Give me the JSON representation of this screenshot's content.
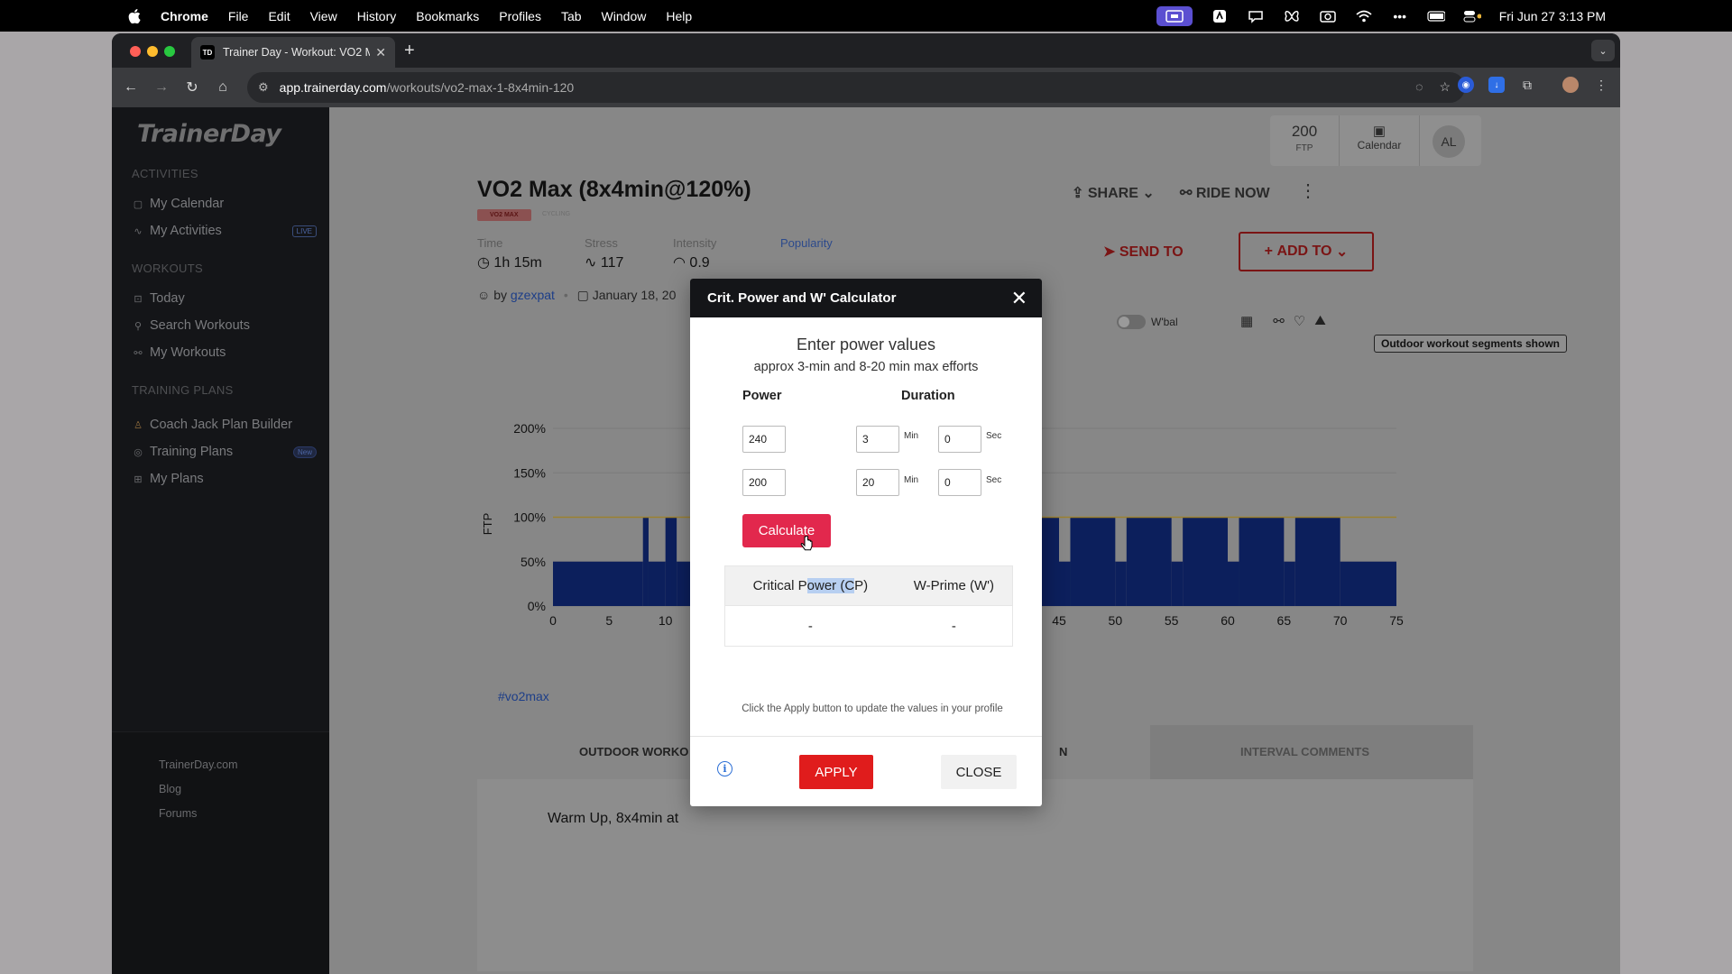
{
  "menubar": {
    "app_name": "Chrome",
    "items": [
      "File",
      "Edit",
      "View",
      "History",
      "Bookmarks",
      "Profiles",
      "Tab",
      "Window",
      "Help"
    ],
    "datetime": "Fri Jun 27  3:13 PM"
  },
  "browser": {
    "tab_title": "Trainer Day - Workout: VO2 M",
    "favicon_text": "TD",
    "url_host": "app.trainerday.com",
    "url_path": "/workouts/vo2-max-1-8x4min-120"
  },
  "sidebar": {
    "logo": "TrainerDay",
    "sections": {
      "activities": "ACTIVITIES",
      "workouts": "WORKOUTS",
      "training_plans": "TRAINING PLANS"
    },
    "items": [
      {
        "label": "My Calendar"
      },
      {
        "label": "My Activities",
        "badge": "LIVE"
      },
      {
        "label": "Today"
      },
      {
        "label": "Search Workouts"
      },
      {
        "label": "My Workouts"
      },
      {
        "label": "Coach Jack Plan Builder"
      },
      {
        "label": "Training Plans",
        "badge": "New"
      },
      {
        "label": "My Plans"
      }
    ],
    "footer": [
      "TrainerDay.com",
      "Blog",
      "Forums"
    ]
  },
  "header": {
    "ftp_value": "200",
    "ftp_label": "FTP",
    "calendar_label": "Calendar",
    "avatar_initials": "AL"
  },
  "workout": {
    "title": "VO2 Max (8x4min@120%)",
    "tag": "VO2 MAX",
    "tag2": "CYCLING",
    "stats": {
      "time_label": "Time",
      "time_value": "1h 15m",
      "stress_label": "Stress",
      "stress_value": "117",
      "intensity_label": "Intensity",
      "intensity_value": "0.9",
      "popularity_label": "Popularity"
    },
    "author_prefix": "by",
    "author": "gzexpat",
    "date": "January 18, 20",
    "hashtag": "#vo2max"
  },
  "actions": {
    "share": "SHARE",
    "ride_now": "RIDE NOW",
    "send_to": "SEND TO",
    "add_to": "ADD TO"
  },
  "chart_controls": {
    "wbal_label": "W'bal",
    "outdoor_label": "Outdoor workout segments shown"
  },
  "chart_data": {
    "type": "area",
    "ylabel": "FTP",
    "ylim": [
      0,
      200
    ],
    "yticks": [
      "0%",
      "50%",
      "100%",
      "150%",
      "200%"
    ],
    "xticks": [
      0,
      5,
      10,
      45,
      50,
      55,
      60,
      65,
      70,
      75
    ],
    "ftp_line": 100,
    "segments": [
      {
        "start": 0,
        "end": 8,
        "value": 50
      },
      {
        "start": 8,
        "end": 8.5,
        "value": 100
      },
      {
        "start": 8.5,
        "end": 10,
        "value": 50
      },
      {
        "start": 10,
        "end": 11,
        "value": 100
      },
      {
        "start": 11,
        "end": 41,
        "value": 50
      },
      {
        "start": 41,
        "end": 45,
        "value": 100
      },
      {
        "start": 45,
        "end": 46,
        "value": 50
      },
      {
        "start": 46,
        "end": 50,
        "value": 100
      },
      {
        "start": 50,
        "end": 51,
        "value": 50
      },
      {
        "start": 51,
        "end": 55,
        "value": 100
      },
      {
        "start": 55,
        "end": 56,
        "value": 50
      },
      {
        "start": 56,
        "end": 60,
        "value": 100
      },
      {
        "start": 60,
        "end": 61,
        "value": 50
      },
      {
        "start": 61,
        "end": 65,
        "value": 100
      },
      {
        "start": 65,
        "end": 66,
        "value": 50
      },
      {
        "start": 66,
        "end": 70,
        "value": 100
      },
      {
        "start": 70,
        "end": 75,
        "value": 50
      }
    ]
  },
  "tabs": {
    "outdoor": "OUTDOOR WORKO",
    "n_fragment": "N",
    "interval_comments": "INTERVAL COMMENTS"
  },
  "content": {
    "text": "Warm Up, 8x4min at"
  },
  "modal": {
    "title": "Crit. Power and W' Calculator",
    "heading": "Enter power values",
    "subheading": "approx 3-min and 8-20 min max efforts",
    "power_col": "Power",
    "duration_col": "Duration",
    "rows": [
      {
        "power": "240",
        "min": "3",
        "sec": "0"
      },
      {
        "power": "200",
        "min": "20",
        "sec": "0"
      }
    ],
    "min_unit": "Min",
    "sec_unit": "Sec",
    "calculate": "Calculate",
    "result_headers": {
      "cp_pre": "Critical P",
      "cp_hl": "ower (C",
      "cp_post": "P)",
      "wprime": "W-Prime (W')"
    },
    "result_values": {
      "cp": "-",
      "wprime": "-"
    },
    "note": "Click the Apply button to update the values in your profile",
    "apply": "APPLY",
    "close": "CLOSE"
  }
}
